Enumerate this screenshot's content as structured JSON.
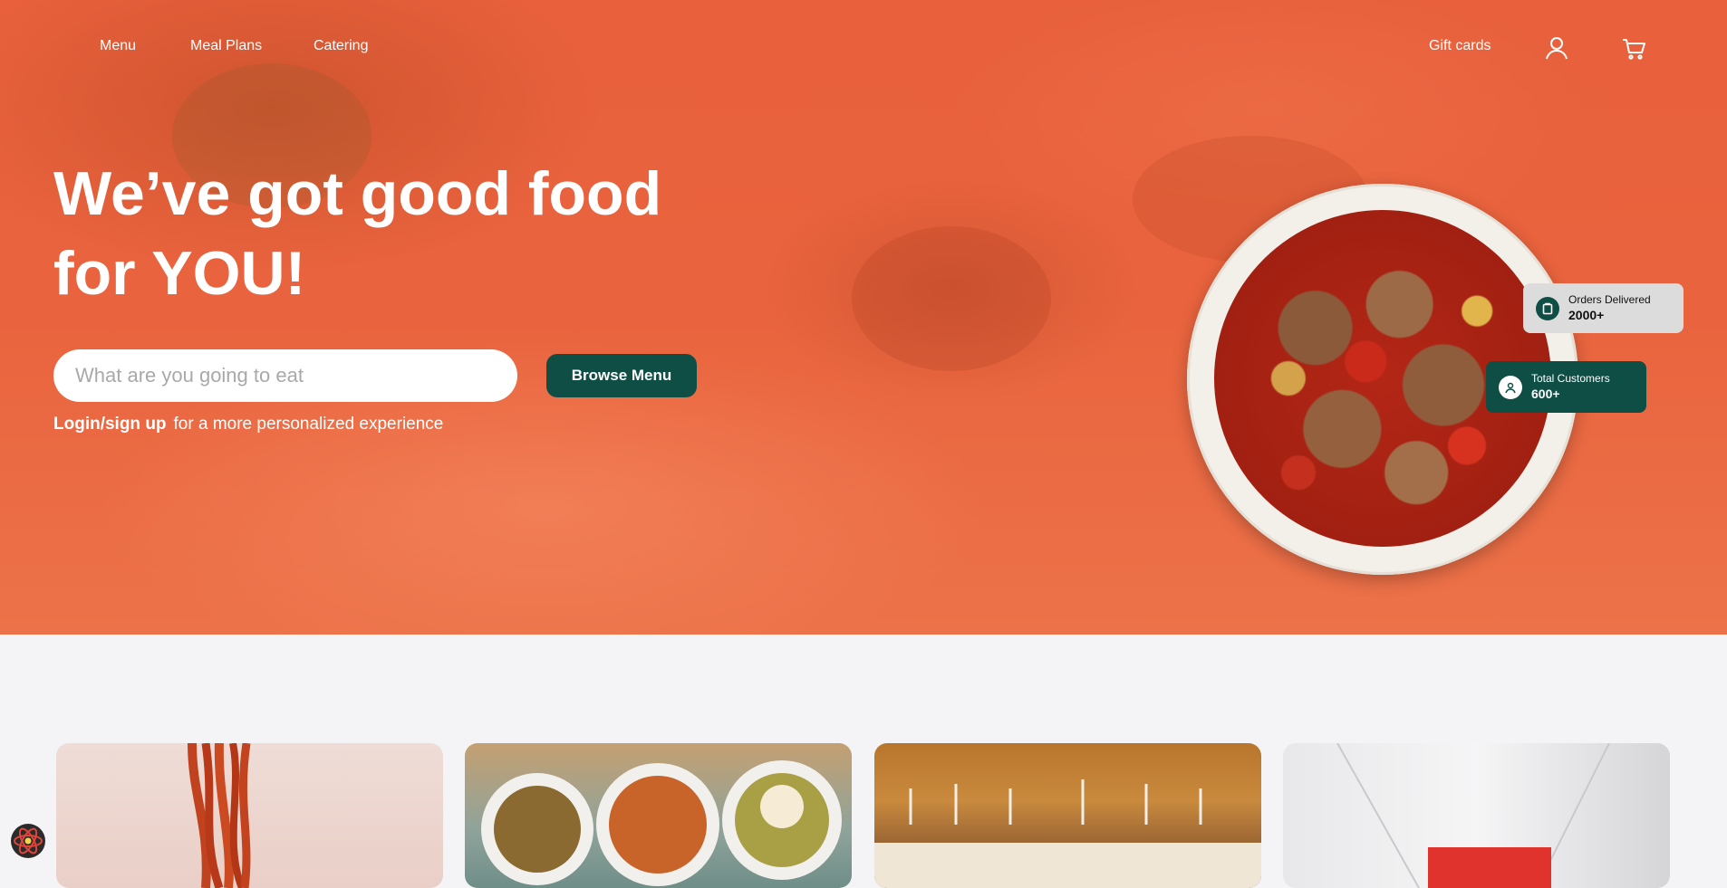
{
  "nav": {
    "links": [
      "Menu",
      "Meal Plans",
      "Catering"
    ],
    "gift_cards": "Gift cards",
    "icons": [
      "user-icon",
      "cart-icon"
    ]
  },
  "hero": {
    "headline_line1": "We’ve got good food",
    "headline_line2": "for YOU!",
    "search_placeholder": "What are you going to eat",
    "browse_button": "Browse Menu",
    "login_link": "Login/sign up",
    "login_rest": "for a more personalized experience"
  },
  "stats": {
    "orders_label": "Orders Delivered",
    "orders_value": "2000+",
    "customers_label": "Total Customers",
    "customers_value": "600+"
  },
  "cards": [
    "pasta-image",
    "plates-image",
    "dining-image",
    "gift-card-image"
  ],
  "colors": {
    "hero": "#e9643e",
    "accent": "#0f4e45",
    "page_bg": "#f4f4f6"
  }
}
